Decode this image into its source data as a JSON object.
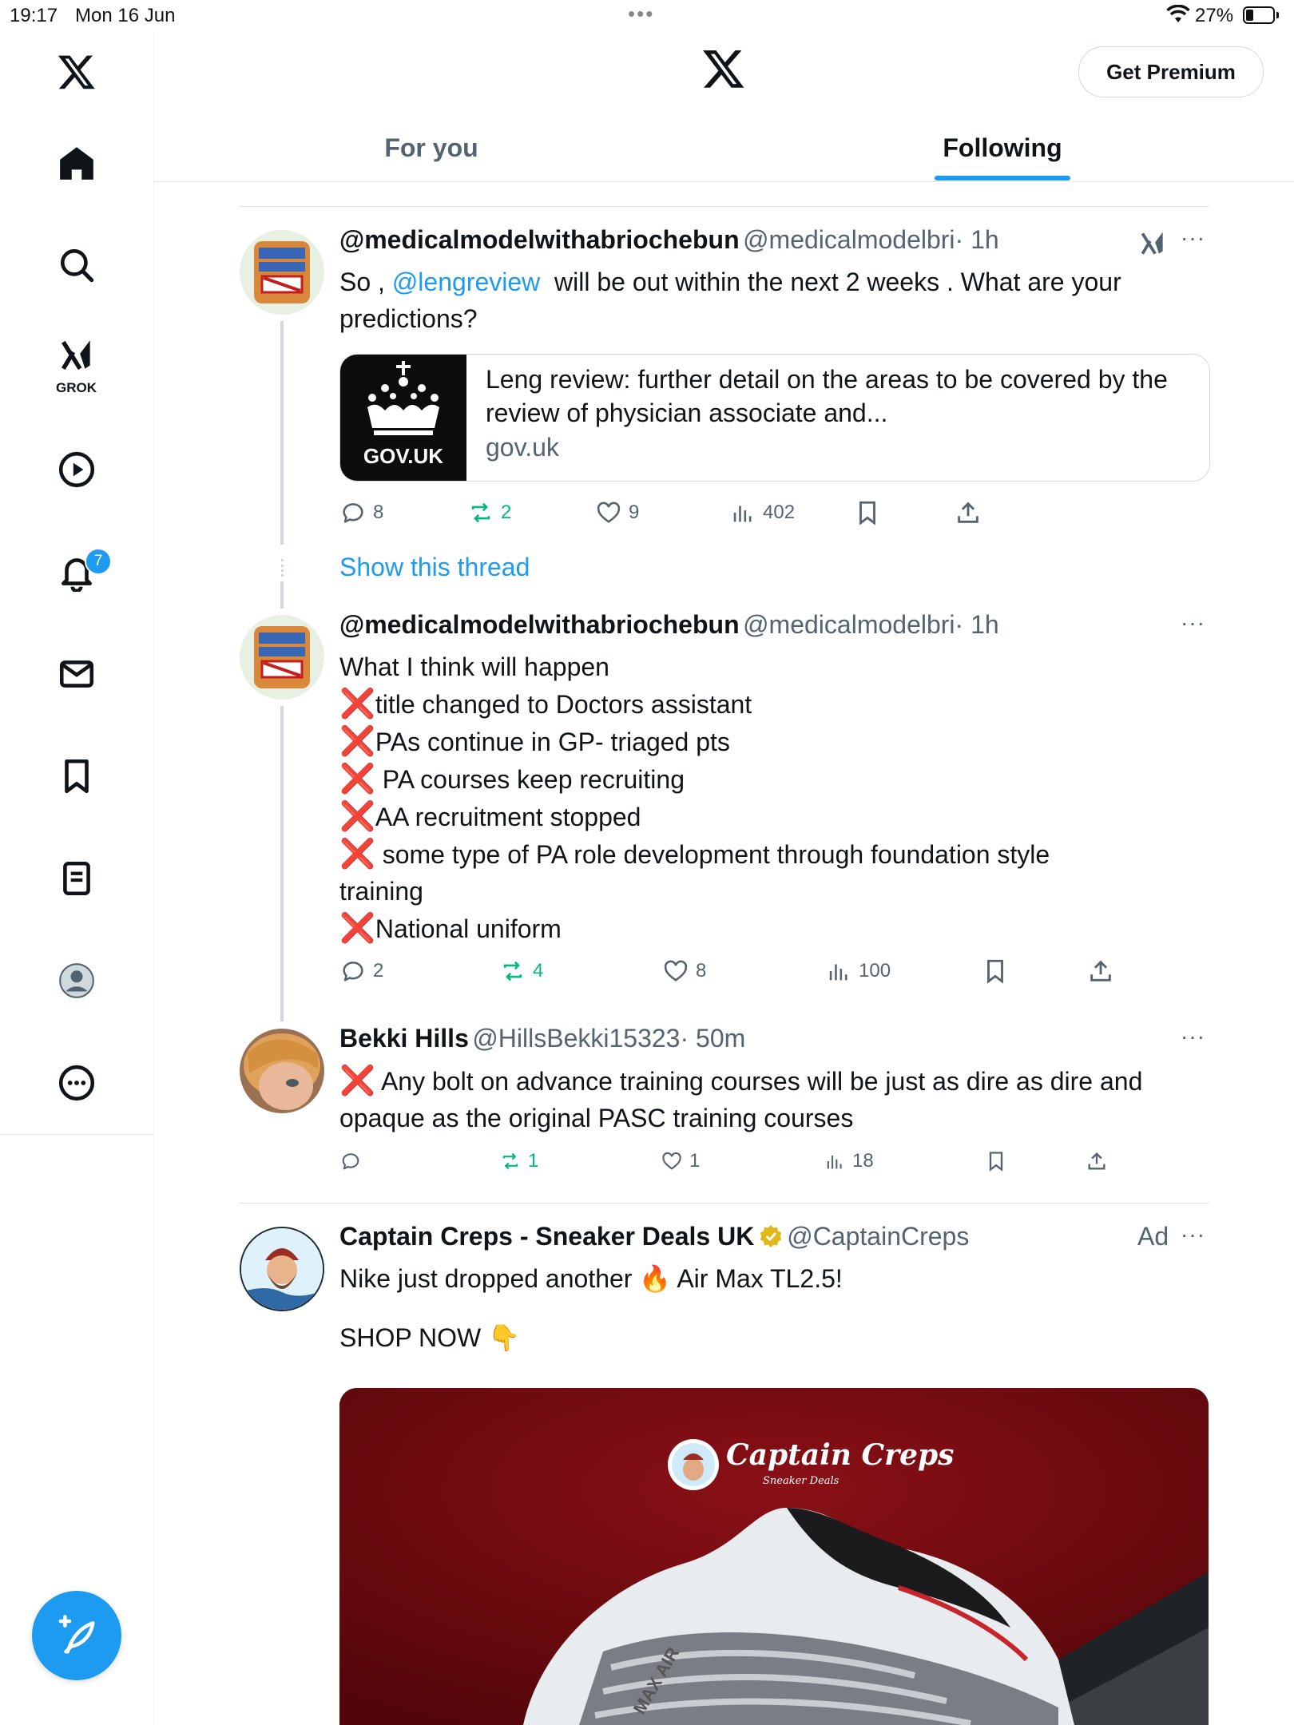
{
  "status_bar": {
    "time": "19:17",
    "date": "Mon 16 Jun",
    "battery_percent": "27%",
    "battery_level": 0.27
  },
  "sidebar": {
    "grok_label": "GROK",
    "notification_count": "7",
    "items": [
      "home",
      "explore",
      "grok",
      "videos",
      "notifications",
      "messages",
      "bookmarks",
      "lists",
      "profile",
      "more"
    ]
  },
  "header": {
    "premium_label": "Get Premium",
    "tabs": [
      {
        "label": "For you",
        "active": false
      },
      {
        "label": "Following",
        "active": true
      }
    ]
  },
  "tweets": [
    {
      "name": "@medicalmodelwithabriochebun",
      "handle": "@medicalmodelbri",
      "time": "· 1h",
      "text_before": "So , ",
      "mention": "@lengreview",
      "text_after": "  will be out within the next 2 weeks . What are your\npredictions?",
      "card": {
        "thumb_label": "GOV.UK",
        "title": "Leng review: further detail on the areas to be covered by the review of physician associate and...",
        "domain": "gov.uk"
      },
      "stats": {
        "replies": "8",
        "reposts": "2",
        "likes": "9",
        "views": "402"
      }
    },
    {
      "show_thread": "Show this thread"
    },
    {
      "name": "@medicalmodelwithabriochebun",
      "handle": "@medicalmodelbri",
      "time": "· 1h",
      "intro": "What I think will happen",
      "x_mark": "❌",
      "lines": [
        "title changed to Doctors assistant",
        "PAs continue in GP- triaged pts",
        " PA courses keep recruiting",
        "AA recruitment stopped",
        " some type of PA role development through foundation style",
        "National uniform"
      ],
      "wrap": "training",
      "stats": {
        "replies": "2",
        "reposts": "4",
        "likes": "8",
        "views": "100"
      }
    },
    {
      "name": "Bekki Hills",
      "handle": "@HillsBekki15323",
      "time": "· 50m",
      "text": " Any bolt on advance training courses will be just as dire as dire and",
      "text2": "opaque as the original PASC training courses",
      "stats": {
        "replies": "",
        "reposts": "1",
        "likes": "1",
        "views": "18"
      }
    },
    {
      "name": "Captain Creps - Sneaker Deals UK",
      "handle": "@CaptainCreps",
      "ad_label": "Ad",
      "text": "Nike just dropped another ",
      "fire": "🔥",
      "text_after": " Air Max TL2.5!",
      "cta": "SHOP NOW ",
      "point": "👇",
      "image_brand": "Captain Creps",
      "image_sub": "Sneaker Deals",
      "shoe_text": "MAX AIR"
    }
  ]
}
